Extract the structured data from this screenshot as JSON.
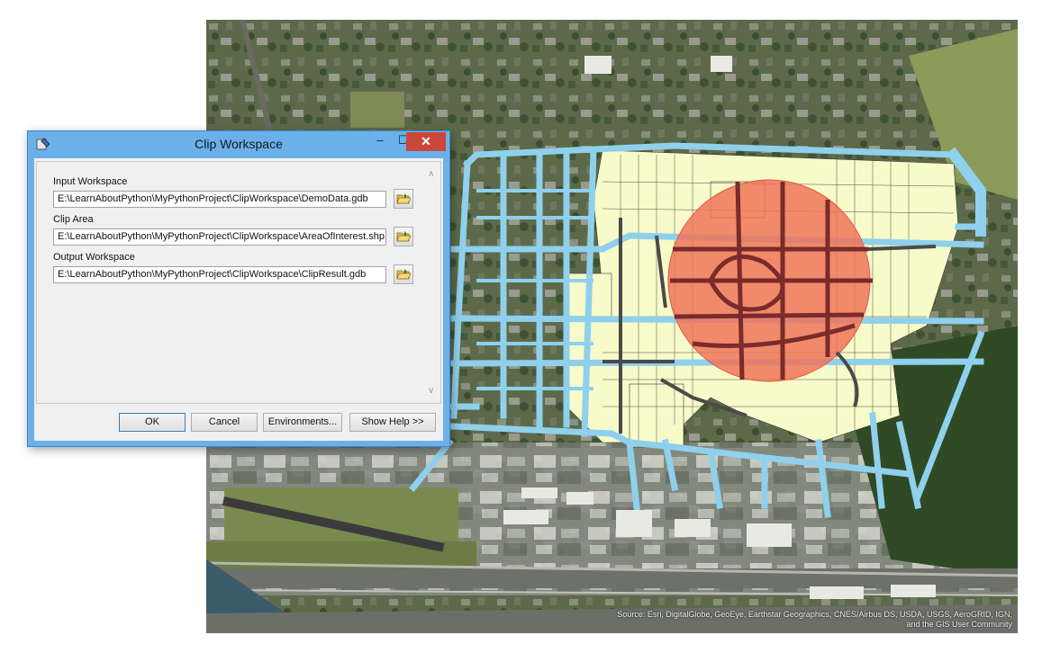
{
  "dialog": {
    "title": "Clip Workspace",
    "icons": {
      "app": "tool-icon",
      "minimize": "minimize-icon",
      "maximize": "maximize-icon",
      "close": "close-icon",
      "browse": "folder-open-icon"
    },
    "fields": [
      {
        "label": "Input Workspace",
        "value": "E:\\LearnAboutPython\\MyPythonProject\\ClipWorkspace\\DemoData.gdb"
      },
      {
        "label": "Clip Area",
        "value": "E:\\LearnAboutPython\\MyPythonProject\\ClipWorkspace\\AreaOfInterest.shp"
      },
      {
        "label": "Output Workspace",
        "value": "E:\\LearnAboutPython\\MyPythonProject\\ClipWorkspace\\ClipResult.gdb"
      }
    ],
    "buttons": {
      "ok": "OK",
      "cancel": "Cancel",
      "environments": "Environments...",
      "help": "Show Help >>"
    }
  },
  "map": {
    "attribution": "Source: Esri, DigitalGlobe, GeoEye, Earthstar Geographics, CNES/Airbus DS, USDA, USGS, AeroGRID, IGN, and the GIS User Community",
    "colors": {
      "imagery": "#4f5f3c",
      "streets": "#8fd0ec",
      "parcels": "#f7fbc9",
      "clip_area": "#f0745a",
      "clipped_streets": "#7a2b2b"
    }
  }
}
